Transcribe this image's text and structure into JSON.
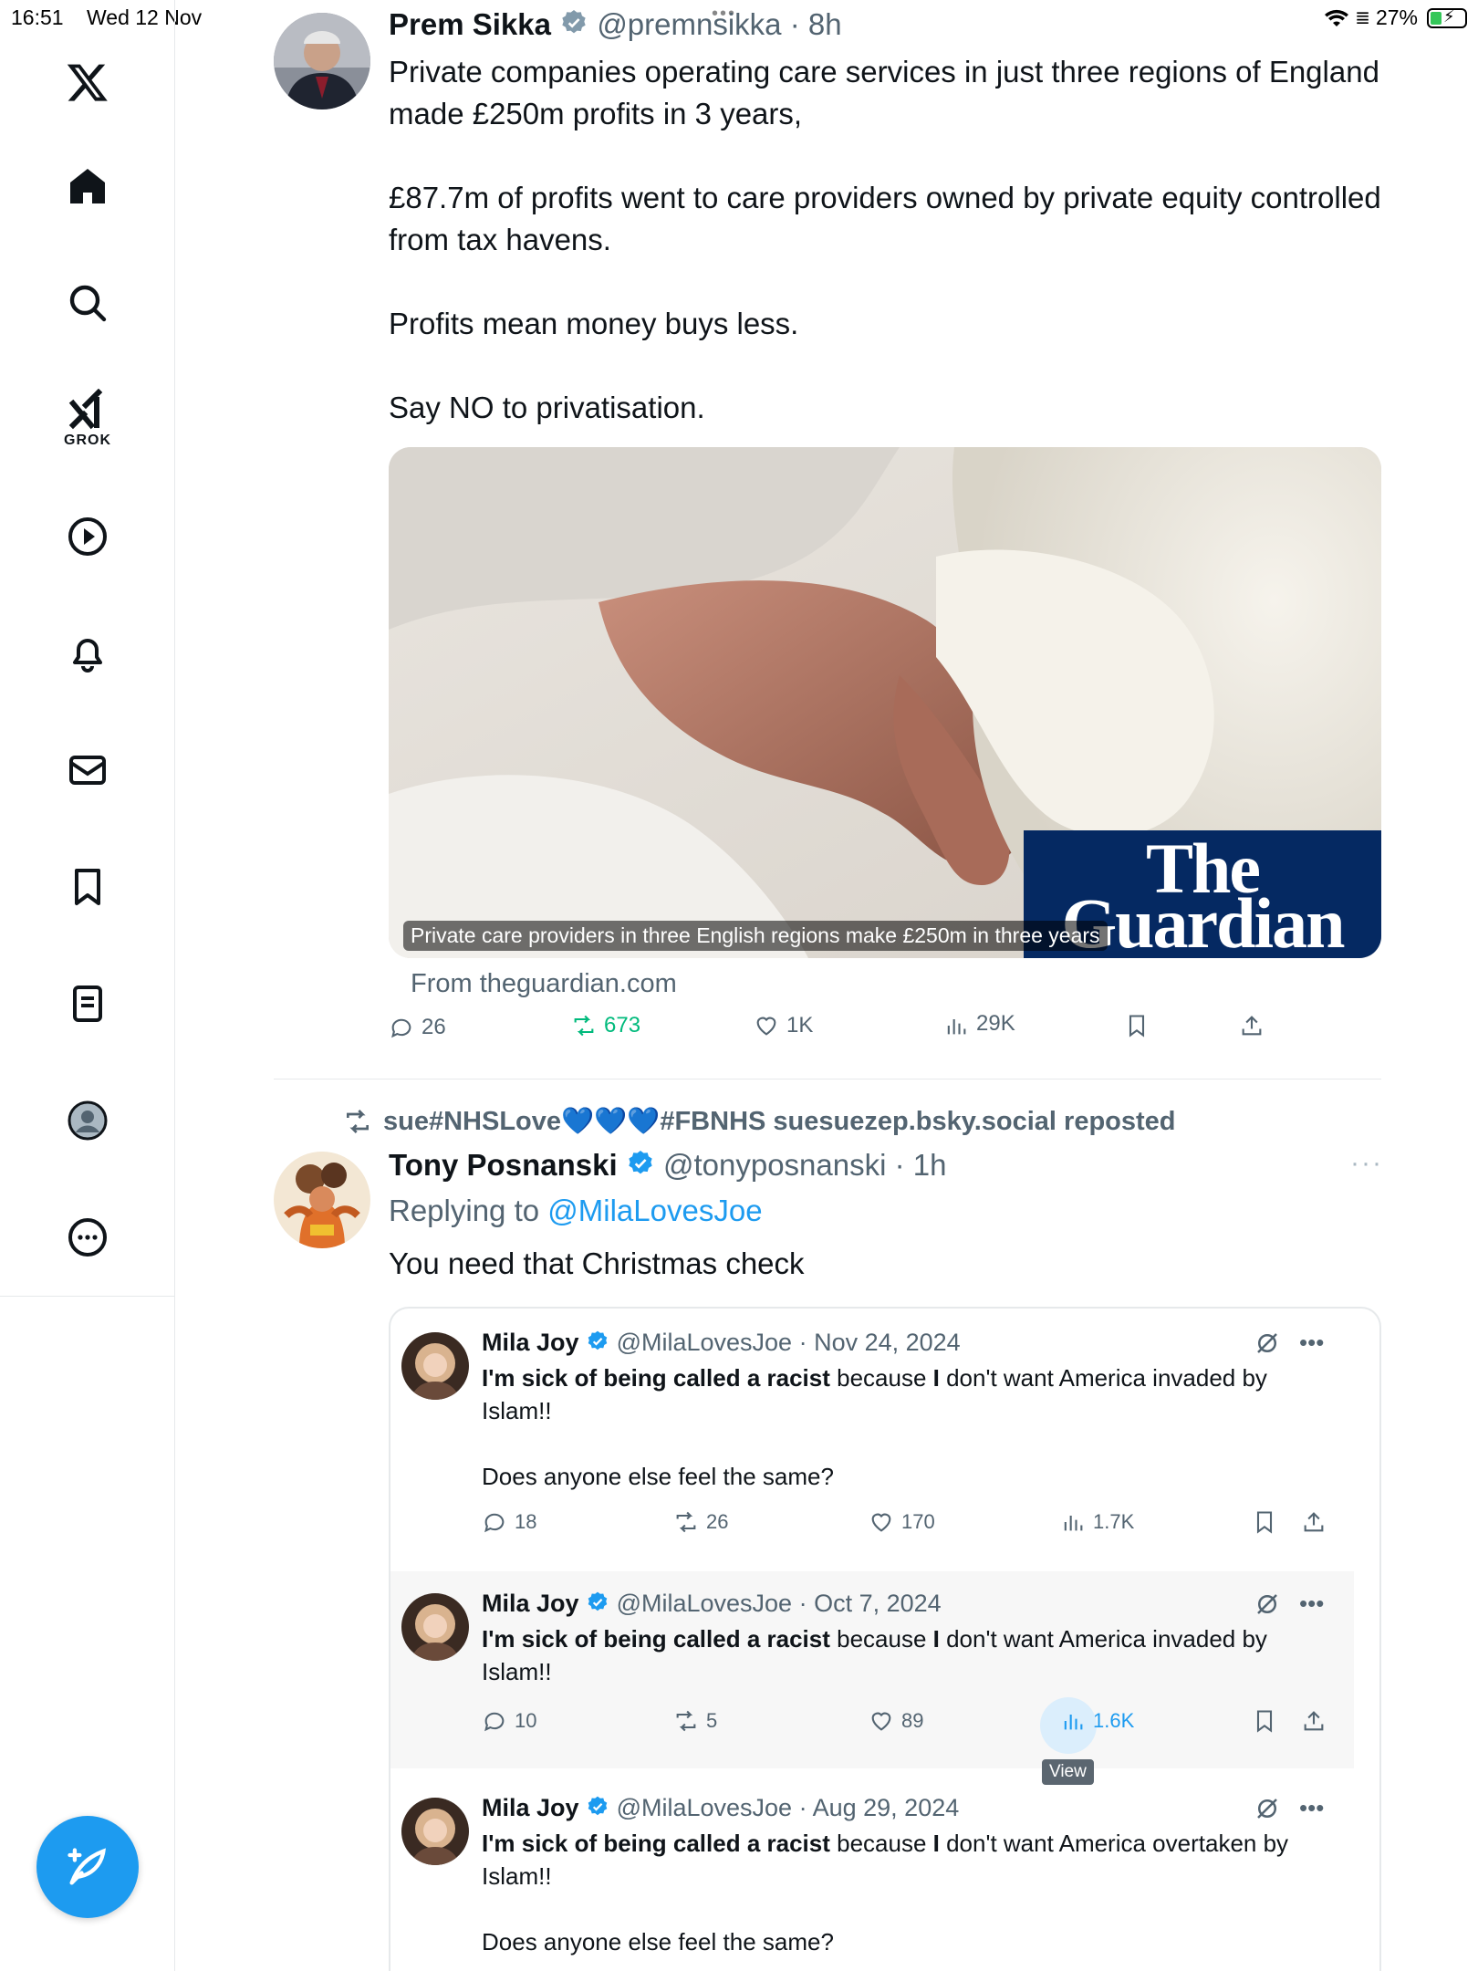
{
  "status": {
    "time": "16:51",
    "date": "Wed 12 Nov",
    "battery": "27%"
  },
  "sidebar": {
    "items": [
      {
        "name": "home"
      },
      {
        "name": "search"
      },
      {
        "name": "grok",
        "label": "GROK"
      },
      {
        "name": "video"
      },
      {
        "name": "notifications"
      },
      {
        "name": "messages"
      },
      {
        "name": "bookmarks"
      },
      {
        "name": "lists"
      },
      {
        "name": "profile"
      },
      {
        "name": "more"
      }
    ]
  },
  "tweet1": {
    "author_name": "Prem Sikka",
    "handle": "@premnsikka",
    "time": "· 8h",
    "paragraphs": [
      "Private companies operating care services in just three regions of England made £250m profits in 3 years,",
      "£87.7m of profits went to care providers owned by private equity controlled from tax havens.",
      "Profits mean money buys less.",
      "Say NO to privatisation."
    ],
    "card": {
      "caption": "Private care providers in three English regions make £250m in three years",
      "brand_line1": "The",
      "brand_line2": "Guardian",
      "source": "From theguardian.com"
    },
    "actions": {
      "replies": "26",
      "reposts": "673",
      "likes": "1K",
      "views": "29K"
    }
  },
  "tweet2": {
    "repost_prefix": "sue#NHSLove",
    "repost_hearts": "💙💙💙",
    "repost_suffix": "#FBNHS suesuezep.bsky.social reposted",
    "author_name": "Tony Posnanski",
    "handle": "@tonyposnanski",
    "time": "· 1h",
    "replying_prefix": "Replying to",
    "replying_handle": "@MilaLovesJoe",
    "text": "You need that Christmas check",
    "more": "···"
  },
  "quoted": [
    {
      "author_name": "Mila Joy",
      "handle": "@MilaLovesJoe",
      "date": "· Nov 24, 2024",
      "b1": "I'm sick of being called a racist",
      "t1": " because ",
      "b2": "I",
      "t2": " don't want America invaded by Islam!!",
      "extra": "Does anyone else feel the same?",
      "replies": "18",
      "reposts": "26",
      "likes": "170",
      "views": "1.7K"
    },
    {
      "author_name": "Mila Joy",
      "handle": "@MilaLovesJoe",
      "date": "· Oct 7, 2024",
      "b1": "I'm sick of being called a racist",
      "t1": " because ",
      "b2": "I",
      "t2": " don't want America invaded by Islam!!",
      "replies": "10",
      "reposts": "5",
      "likes": "89",
      "views": "1.6K",
      "tooltip": "View"
    },
    {
      "author_name": "Mila Joy",
      "handle": "@MilaLovesJoe",
      "date": "· Aug 29, 2024",
      "b1": "I'm sick of being called a racist",
      "t1": " because ",
      "b2": "I",
      "t2": " don't want America overtaken by Islam!!",
      "extra": "Does anyone else feel the same?"
    }
  ],
  "colors": {
    "accent": "#1d9bf0",
    "repost_green": "#00ba7c",
    "muted": "#536471",
    "guardian_blue": "#052962"
  }
}
